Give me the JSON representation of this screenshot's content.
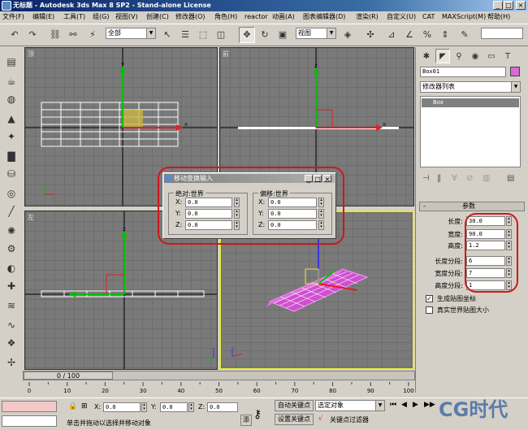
{
  "window": {
    "title": "无标题 - Autodesk 3ds Max 8 SP2 - Stand-alone License",
    "min": "_",
    "max": "□",
    "close": "×"
  },
  "menu": [
    "文件(F)",
    "编辑(E)",
    "工具(T)",
    "组(G)",
    "视图(V)",
    "创建(C)",
    "修改器(O)",
    "角色(H)",
    "reactor",
    "动画(A)",
    "图表编辑器(D)",
    "渲染(R)",
    "自定义(U)",
    "CAT",
    "MAXScript(M)",
    "帮助(H)"
  ],
  "toolbar": {
    "selection_filter": "全部",
    "coord_system": "视图"
  },
  "viewports": {
    "top": "顶",
    "front": "前",
    "left": "左",
    "perspective": "透"
  },
  "axis_labels": {
    "x": "x",
    "y": "y",
    "z": "z"
  },
  "command_panel": {
    "object_name": "Box01",
    "modifier_list": "修改器列表",
    "stack_item": "Box",
    "rollout_minus": "-",
    "rollout_title": "参数",
    "params": [
      {
        "label": "长度:",
        "value": "30.0"
      },
      {
        "label": "宽度:",
        "value": "90.0"
      },
      {
        "label": "高度:",
        "value": "1.2"
      },
      {
        "label": "长度分段:",
        "value": "6"
      },
      {
        "label": "宽度分段:",
        "value": "7"
      },
      {
        "label": "高度分段:",
        "value": "1"
      }
    ],
    "gen_mapping": "生成贴图坐标",
    "real_world": "真实世界贴图大小",
    "object_color": "#d86ad8"
  },
  "dialog": {
    "title": "移动变换输入",
    "absolute_group": "绝对:世界",
    "offset_group": "偏移:世界",
    "abs": {
      "x": "0.0",
      "y": "0.0",
      "z": "0.0"
    },
    "off": {
      "x": "0.0",
      "y": "0.0",
      "z": "0.0"
    },
    "axis_x": "X:",
    "axis_y": "Y:",
    "axis_z": "Z:"
  },
  "timeline": {
    "frame_display": "0 / 100",
    "ticks": [
      "0",
      "10",
      "20",
      "30",
      "40",
      "50",
      "60",
      "70",
      "80",
      "90",
      "100"
    ]
  },
  "status": {
    "x_label": "X:",
    "x_value": "0.0",
    "y_label": "Y:",
    "y_value": "0.0",
    "z_label": "Z:",
    "z_value": "0.0",
    "prompt": "单击并拖动以选择并移动对象",
    "add_label": "添",
    "auto_key": "自动关键点",
    "selected_object": "选定对象",
    "set_key": "设置关键点",
    "key_filters": "关键点过滤器",
    "watermark": "CG时代"
  }
}
